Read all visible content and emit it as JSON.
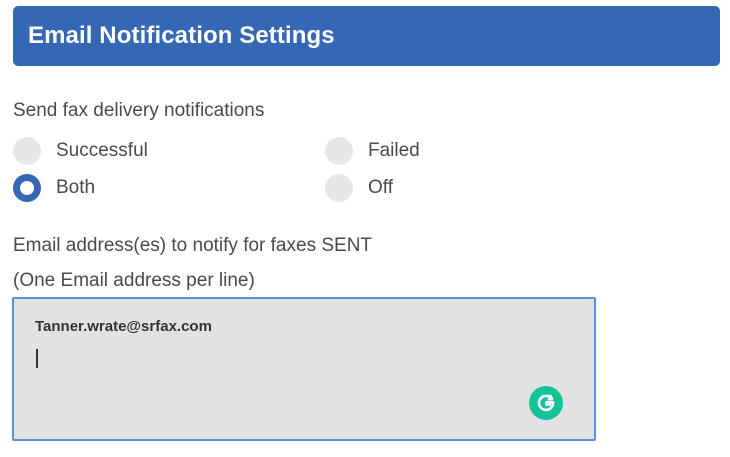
{
  "colors": {
    "accent": "#3567b4",
    "header_bg": "#3567b4",
    "grammarly_green": "#15c39a"
  },
  "header": {
    "title": "Email Notification Settings"
  },
  "fax_notifications": {
    "label": "Send fax delivery notifications",
    "selected": "Both",
    "options": [
      {
        "label": "Successful",
        "checked": false
      },
      {
        "label": "Failed",
        "checked": false
      },
      {
        "label": "Both",
        "checked": true
      },
      {
        "label": "Off",
        "checked": false
      }
    ]
  },
  "email_sent": {
    "label": "Email address(es) to notify for faxes SENT",
    "hint": "(One Email address per line)",
    "value": "Tanner.wrate@srfax.com",
    "assistant_icon": "grammarly-icon"
  }
}
